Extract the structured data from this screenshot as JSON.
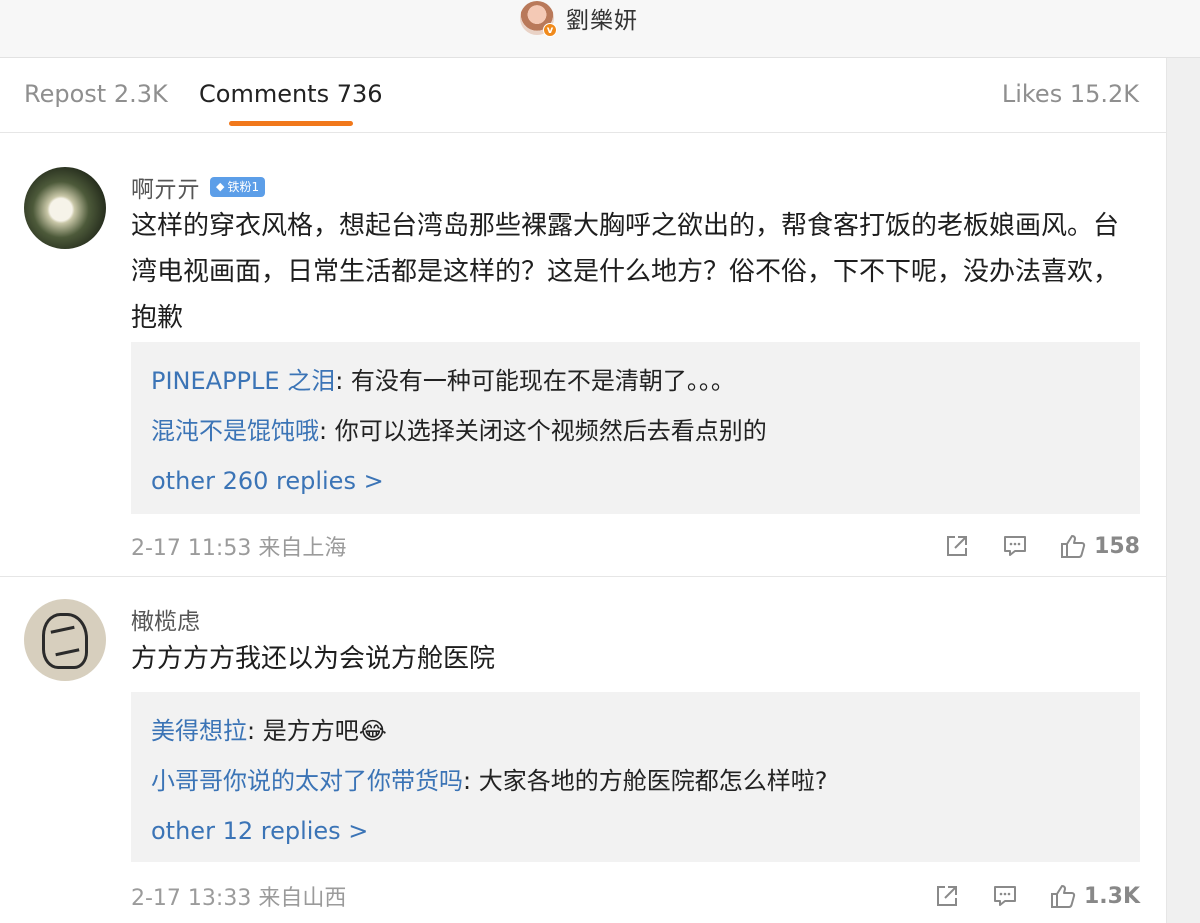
{
  "header": {
    "author_name": "劉樂妍",
    "verified_mark": "v"
  },
  "tabs": {
    "repost": "Repost 2.3K",
    "comments": "Comments 736",
    "likes": "Likes 15.2K"
  },
  "comments": [
    {
      "username": "啊亓亓",
      "badge_icon": "◆",
      "badge": "铁粉1",
      "text": "这样的穿衣风格，想起台湾岛那些裸露大胸呼之欲出的，帮食客打饭的老板娘画风。台湾电视画面，日常生活都是这样的？这是什么地方？俗不俗，下不下呢，没办法喜欢，抱歉",
      "replies": [
        {
          "name": "PINEAPPLE 之泪",
          "text": ": 有没有一种可能现在不是清朝了。。。"
        },
        {
          "name": "混沌不是馄饨哦",
          "text": ": 你可以选择关闭这个视频然后去看点别的"
        }
      ],
      "more_replies": "other 260 replies >",
      "time": "2-17 11:53 来自上海",
      "likes": "158"
    },
    {
      "username": "橄榄虑",
      "text": "方方方方我还以为会说方舱医院",
      "replies": [
        {
          "name": "美得想拉",
          "text": ": 是方方吧😂"
        },
        {
          "name": "小哥哥你说的太对了你带货吗",
          "text": ": 大家各地的方舱医院都怎么样啦?"
        }
      ],
      "more_replies": "other 12 replies >",
      "time": "2-17 13:33 来自山西",
      "likes": "1.3K"
    }
  ]
}
